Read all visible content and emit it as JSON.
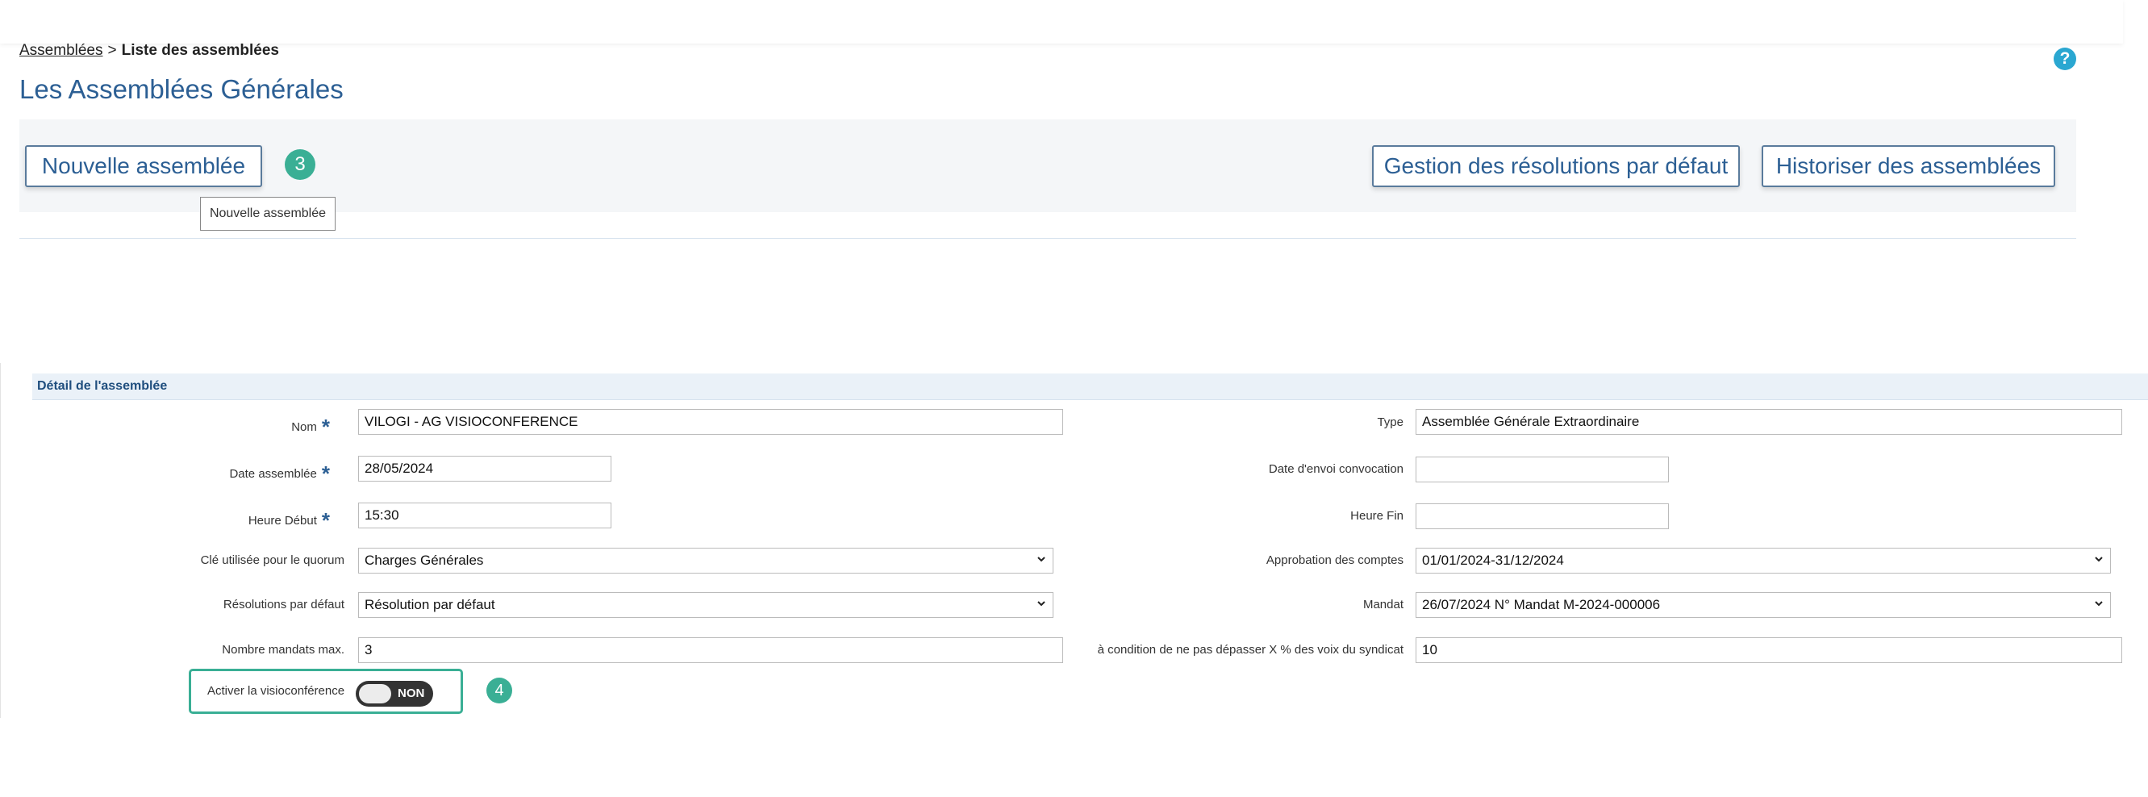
{
  "breadcrumb": {
    "parent": "Assemblées",
    "separator": ">",
    "current": "Liste des assemblées"
  },
  "page_title": "Les Assemblées Générales",
  "toolbar": {
    "new_label": "Nouvelle assemblée",
    "resolutions_label": "Gestion des résolutions par défaut",
    "history_label": "Historiser des assemblées"
  },
  "tooltip": "Nouvelle assemblée",
  "badges": {
    "step3": "3",
    "step4": "4"
  },
  "section_title": "Détail de l'assemblée",
  "form": {
    "nom_label": "Nom",
    "nom_value": "VILOGI - AG VISIOCONFERENCE",
    "type_label": "Type",
    "type_value": "Assemblée Générale Extraordinaire",
    "date_label": "Date assemblée",
    "date_value": "28/05/2024",
    "envoi_label": "Date d'envoi convocation",
    "envoi_value": "",
    "heure_debut_label": "Heure Début",
    "heure_debut_value": "15:30",
    "heure_fin_label": "Heure Fin",
    "heure_fin_value": "",
    "cle_label": "Clé utilisée pour le quorum",
    "cle_value": "Charges Générales",
    "approbation_label": "Approbation des comptes",
    "approbation_value": "01/01/2024-31/12/2024",
    "resolutions_label": "Résolutions par défaut",
    "resolutions_value": "Résolution par défaut",
    "mandat_label": "Mandat",
    "mandat_value": "26/07/2024 N° Mandat M-2024-000006",
    "mandats_max_label": "Nombre mandats max.",
    "mandats_max_value": "3",
    "condition_label": "à condition de ne pas dépasser X % des voix du syndicat",
    "condition_value": "10",
    "required_marker": "*"
  },
  "visio": {
    "label": "Activer la visioconférence",
    "toggle_state": "NON"
  },
  "colors": {
    "accent": "#2c5f94",
    "badge": "#3aaf95",
    "help": "#2aa7d1"
  }
}
